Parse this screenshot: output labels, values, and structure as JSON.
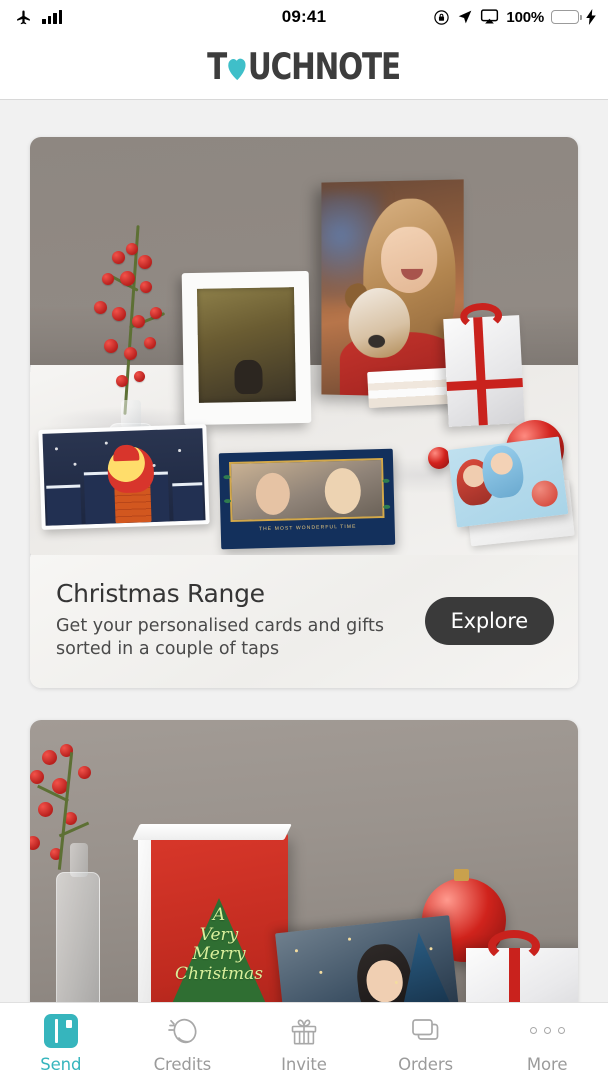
{
  "status_bar": {
    "airplane_icon": "airplane-icon",
    "signal_icon": "signal-bars-icon",
    "time": "09:41",
    "rotation_lock_icon": "rotation-lock-icon",
    "location_icon": "location-arrow-icon",
    "airplay_icon": "airplay-icon",
    "battery_percent": "100%",
    "charging_icon": "lightning-bolt-icon"
  },
  "header": {
    "brand_part1": "T",
    "brand_heart": "heart-icon",
    "brand_part2": "UCHNOTE",
    "brand_color": "#3d3d3d",
    "heart_color": "#3fbfc9"
  },
  "cards": [
    {
      "image_alt": "christmas-range-photo",
      "title": "Christmas Range",
      "subtitle": "Get your personalised cards and gifts sorted in a couple of taps",
      "button_label": "Explore",
      "button_color": "#3a3a3a",
      "photo_card_text": "THE MOST WONDERFUL TIME"
    },
    {
      "image_alt": "merry-christmas-photo",
      "card_line1": "A",
      "card_line2": "Very",
      "card_line3": "Merry",
      "card_line4": "Christmas"
    }
  ],
  "tabbar": {
    "items": [
      {
        "label": "Send",
        "icon": "send-card-icon",
        "active": true
      },
      {
        "label": "Credits",
        "icon": "coin-flip-icon",
        "active": false
      },
      {
        "label": "Invite",
        "icon": "gift-box-icon",
        "active": false
      },
      {
        "label": "Orders",
        "icon": "stacked-cards-icon",
        "active": false
      },
      {
        "label": "More",
        "icon": "three-dots-icon",
        "active": false
      }
    ],
    "active_color": "#36b5bd",
    "inactive_color": "#9b9b9b"
  }
}
